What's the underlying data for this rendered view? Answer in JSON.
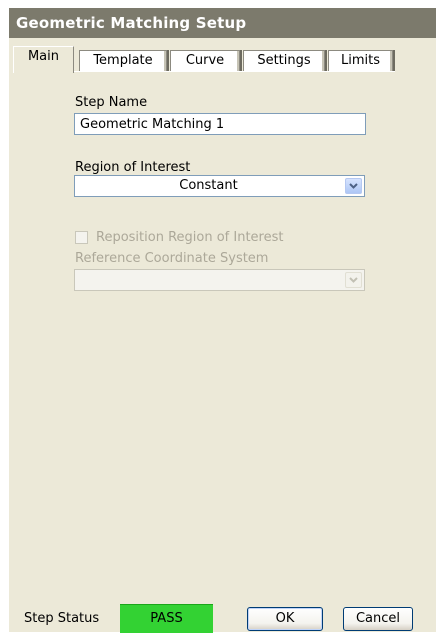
{
  "window": {
    "title": "Geometric Matching Setup"
  },
  "tabs": [
    {
      "label": "Main",
      "active": true
    },
    {
      "label": "Template",
      "active": false
    },
    {
      "label": "Curve",
      "active": false
    },
    {
      "label": "Settings",
      "active": false
    },
    {
      "label": "Limits",
      "active": false
    }
  ],
  "step_name": {
    "label": "Step Name",
    "value": "Geometric Matching 1"
  },
  "roi": {
    "label": "Region of Interest",
    "selected": "Constant"
  },
  "reposition": {
    "label": "Reposition Region of Interest",
    "checked": false,
    "enabled": false
  },
  "ref_coord": {
    "label": "Reference Coordinate System",
    "selected": "",
    "enabled": false
  },
  "footer": {
    "status_label": "Step Status",
    "status_value": "PASS",
    "status_color": "#33d233",
    "ok_label": "OK",
    "cancel_label": "Cancel"
  },
  "icons": {
    "dropdown": "chevron-down-icon"
  }
}
